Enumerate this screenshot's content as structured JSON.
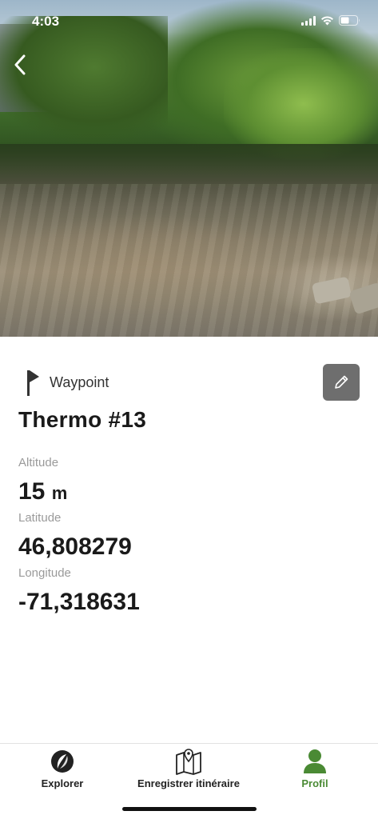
{
  "status_bar": {
    "time": "4:03"
  },
  "photo": {
    "subject": "stream-photo"
  },
  "waypoint": {
    "type_label": "Waypoint",
    "title": "Thermo #13",
    "fields": {
      "altitude": {
        "label": "Altitude",
        "value": "15",
        "unit": "m"
      },
      "latitude": {
        "label": "Latitude",
        "value": "46,808279"
      },
      "longitude": {
        "label": "Longitude",
        "value": "-71,318631"
      }
    }
  },
  "tabs": [
    {
      "label": "Explorer",
      "icon": "compass-leaf-icon",
      "active": false
    },
    {
      "label": "Enregistrer itinéraire",
      "icon": "map-pin-icon",
      "active": false
    },
    {
      "label": "Profil",
      "icon": "person-icon",
      "active": true
    }
  ],
  "colors": {
    "accent": "#4a8a34",
    "edit_button": "#6e6e6e",
    "label_gray": "#9a9a9a"
  }
}
